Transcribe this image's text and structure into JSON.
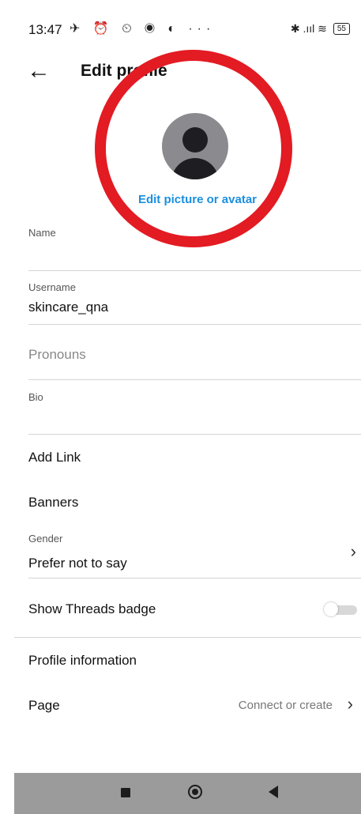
{
  "status_bar": {
    "time": "13:47",
    "left_icons": "✈ ⏰ ⏲ ◉ ◐  ···",
    "right_icons": "✱ .ııl ≋",
    "battery": "55"
  },
  "header": {
    "back_icon": "←",
    "title": "Edit profile"
  },
  "avatar": {
    "edit_label": "Edit picture or avatar"
  },
  "form": {
    "name_label": "Name",
    "username_label": "Username",
    "username_value": "skincare_qna",
    "pronouns_placeholder": "Pronouns",
    "bio_label": "Bio",
    "add_link": "Add Link",
    "banners": "Banners",
    "gender_label": "Gender",
    "gender_value": "Prefer not to say",
    "gender_chevron": "›",
    "threads_badge": "Show Threads badge",
    "threads_badge_on": false,
    "profile_information": "Profile information",
    "page_label": "Page",
    "page_value": "Connect or create",
    "page_chevron": "›"
  },
  "colors": {
    "accent": "#1a8fe0",
    "annotation_ring": "#e31b23",
    "navbar": "#9b9b9b"
  }
}
